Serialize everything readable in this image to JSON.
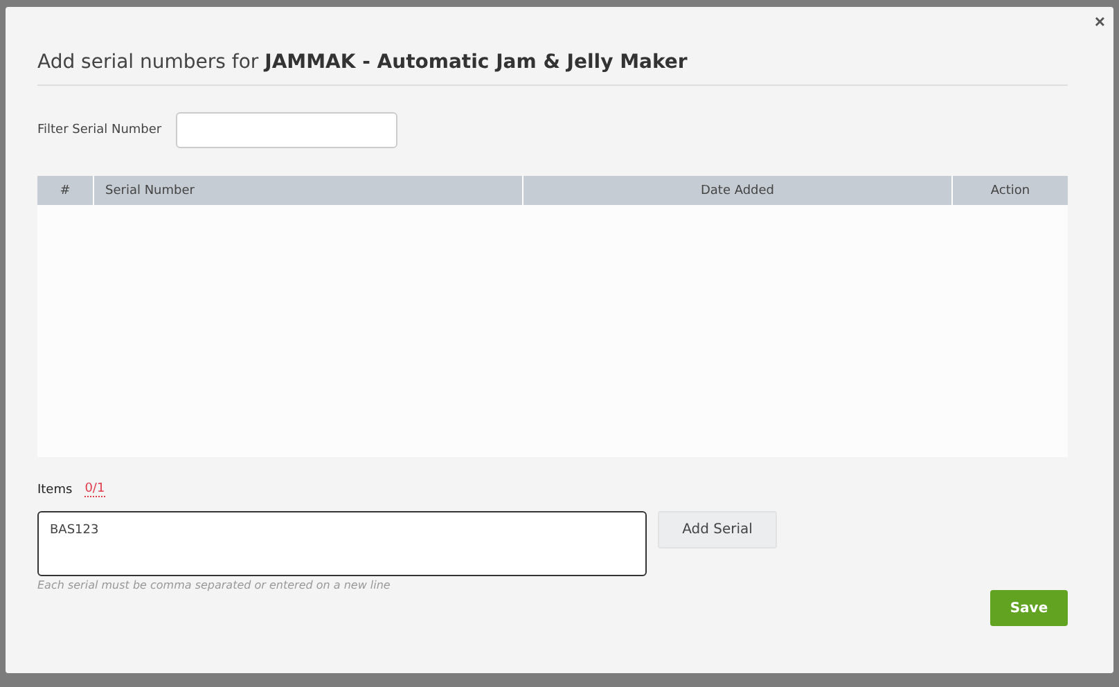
{
  "dialog": {
    "close": "×",
    "title": "Add serial numbers for **JAMMAK - Automatic Jam & Jelly Maker**"
  },
  "filter": {
    "label": "Filter Serial Number"
  },
  "table": {
    "columns": [
      "#",
      "Serial Number",
      "Date Added",
      "Action"
    ]
  },
  "items": {
    "label": "Items",
    "count": "0/1"
  },
  "serial_input": {
    "value": "BAS123"
  },
  "add_button": "Add Serial",
  "hint": "Each serial must be comma separated or entered on a new line",
  "save_button": "Save"
}
